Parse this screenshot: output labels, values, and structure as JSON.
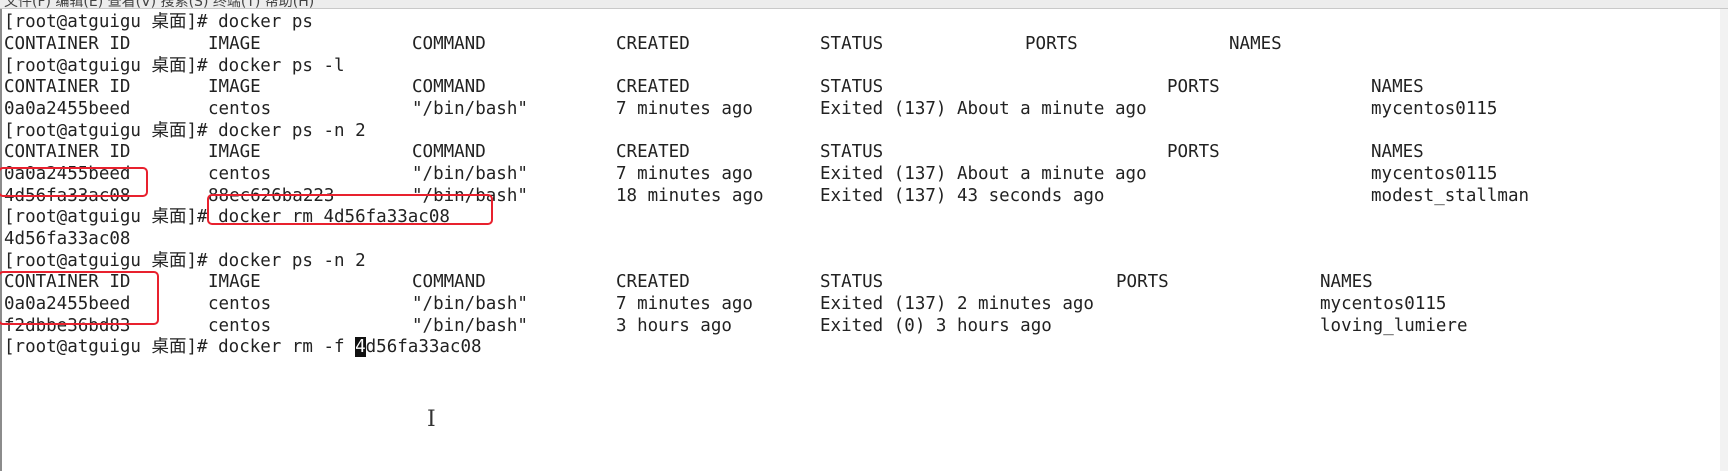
{
  "window": {
    "menubar_text": "文件(F)   编辑(E)   查看(V)   搜索(S)   终端(T)   帮助(H)"
  },
  "terminal": {
    "lines": [
      {
        "type": "prompt",
        "prompt": "[root@atguigu 桌面]#",
        "command": "docker ps"
      },
      {
        "type": "header",
        "cells": [
          "CONTAINER ID",
          "IMAGE",
          "COMMAND",
          "CREATED",
          "STATUS",
          "PORTS",
          "NAMES"
        ]
      },
      {
        "type": "prompt",
        "prompt": "[root@atguigu 桌面]#",
        "command": "docker ps -l"
      },
      {
        "type": "header",
        "cells": [
          "CONTAINER ID",
          "IMAGE",
          "COMMAND",
          "CREATED",
          "STATUS",
          "PORTS",
          "NAMES"
        ]
      },
      {
        "type": "row",
        "cells": [
          "0a0a2455beed",
          "centos",
          "\"/bin/bash\"",
          "7 minutes ago",
          "Exited (137) About a minute ago",
          "",
          "mycentos0115"
        ]
      },
      {
        "type": "prompt",
        "prompt": "[root@atguigu 桌面]#",
        "command": "docker ps -n 2"
      },
      {
        "type": "header",
        "cells": [
          "CONTAINER ID",
          "IMAGE",
          "COMMAND",
          "CREATED",
          "STATUS",
          "PORTS",
          "NAMES"
        ]
      },
      {
        "type": "row",
        "cells": [
          "0a0a2455beed",
          "centos",
          "\"/bin/bash\"",
          "7 minutes ago",
          "Exited (137) About a minute ago",
          "",
          "mycentos0115"
        ]
      },
      {
        "type": "row",
        "cells": [
          "4d56fa33ac08",
          "88ec626ba223",
          "\"/bin/bash\"",
          "18 minutes ago",
          "Exited (137) 43 seconds ago",
          "",
          "modest_stallman"
        ]
      },
      {
        "type": "prompt",
        "prompt": "[root@atguigu 桌面]#",
        "command": "docker rm 4d56fa33ac08"
      },
      {
        "type": "output",
        "text": "4d56fa33ac08"
      },
      {
        "type": "prompt",
        "prompt": "[root@atguigu 桌面]#",
        "command": "docker ps -n 2"
      },
      {
        "type": "header",
        "cells": [
          "CONTAINER ID",
          "IMAGE",
          "COMMAND",
          "CREATED",
          "STATUS",
          "PORTS",
          "NAMES"
        ]
      },
      {
        "type": "row",
        "cells": [
          "0a0a2455beed",
          "centos",
          "\"/bin/bash\"",
          "7 minutes ago",
          "Exited (137) 2 minutes ago",
          "",
          "mycentos0115"
        ]
      },
      {
        "type": "row",
        "cells": [
          "f2dbbe36bd83",
          "centos",
          "\"/bin/bash\"",
          "3 hours ago",
          "Exited (0) 3 hours ago",
          "",
          "loving_lumiere"
        ]
      },
      {
        "type": "prompt",
        "prompt": "[root@atguigu 桌面]#",
        "command_before_cursor": "docker rm -f ",
        "cursor_char": "4",
        "command_after_cursor": "d56fa33ac08"
      }
    ]
  },
  "colors": {
    "highlight_box": "#e8212e",
    "cursor": "#111111"
  },
  "icons": {
    "mouse_cursor": "i-beam-cursor-icon"
  }
}
